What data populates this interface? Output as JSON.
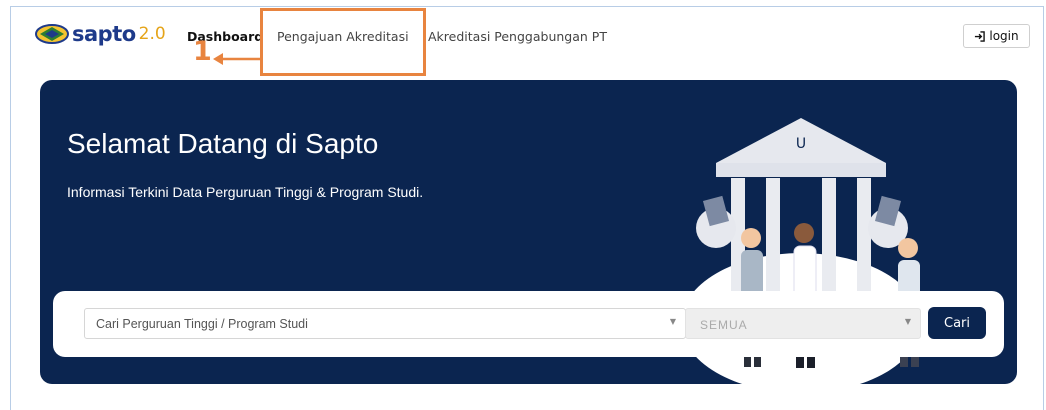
{
  "brand": {
    "name": "sapto",
    "version": "2.0"
  },
  "nav": {
    "items": [
      {
        "label": "Dashboard"
      },
      {
        "label": "Pengajuan Akreditasi"
      },
      {
        "label": "Akreditasi Penggabungan PT"
      }
    ],
    "login_label": "login",
    "login_icon": "sign-in-icon"
  },
  "annotation": {
    "number": "1",
    "color": "#e8843f"
  },
  "hero": {
    "title": "Selamat Datang di Sapto",
    "subtitle": "Informasi Terkini Data Perguruan Tinggi & Program Studi.",
    "background": "#0b2550"
  },
  "search": {
    "placeholder": "Cari Perguruan Tinggi / Program Studi",
    "filter_value": "SEMUA",
    "button_label": "Cari"
  }
}
